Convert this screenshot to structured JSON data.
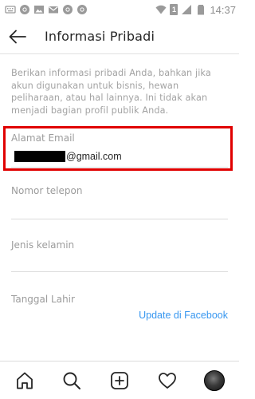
{
  "status_bar": {
    "time": "14:37",
    "sim_label": "1",
    "left_icons": [
      "keyboard-icon",
      "chrome-icon",
      "image-icon",
      "mail-icon",
      "chrome-icon",
      "chrome-icon"
    ],
    "right_icons": [
      "wifi-icon",
      "sim-badge",
      "signal-icon",
      "battery-icon"
    ]
  },
  "header": {
    "title": "Informasi Pribadi"
  },
  "description": "Berikan informasi pribadi Anda, bahkan jika akun digunakan untuk bisnis, hewan peliharaan, atau hal lainnya. Ini tidak akan menjadi bagian profil publik Anda.",
  "fields": {
    "email": {
      "label": "Alamat Email",
      "value_suffix": "@gmail.com",
      "highlight_color": "#e00000"
    },
    "phone": {
      "label": "Nomor telepon",
      "value": ""
    },
    "gender": {
      "label": "Jenis kelamin",
      "value": ""
    },
    "birthday": {
      "label": "Tanggal Lahir",
      "value": ""
    }
  },
  "facebook_link": "Update di Facebook",
  "colors": {
    "link": "#3897f0",
    "text": "#262626",
    "muted": "#a3a3a3",
    "highlight": "#e00000"
  },
  "bottom_nav": [
    "home-icon",
    "search-icon",
    "add-icon",
    "heart-icon",
    "profile-avatar"
  ]
}
